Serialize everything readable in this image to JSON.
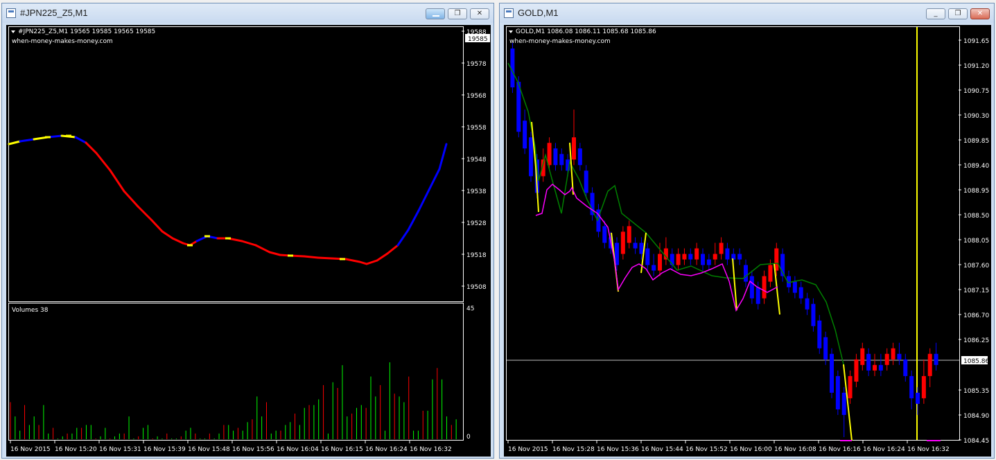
{
  "left_window": {
    "title": "#JPN225_Z5,M1",
    "header": "#JPN225_Z5,M1  19565 19585 19565 19585",
    "watermark": "when-money-makes-money.com",
    "price_labels": [
      "19588",
      "19578",
      "19568",
      "19558",
      "19548",
      "19538",
      "19528",
      "19518",
      "19508"
    ],
    "current_price": "19585",
    "volume_label": "Volumes 38",
    "volume_max": "45",
    "volume_min": "0",
    "time_labels": [
      "16 Nov 2015",
      "16 Nov 15:20",
      "16 Nov 15:31",
      "16 Nov 15:39",
      "16 Nov 15:48",
      "16 Nov 15:56",
      "16 Nov 16:04",
      "16 Nov 16:15",
      "16 Nov 16:24",
      "16 Nov 16:32"
    ]
  },
  "right_window": {
    "title": "GOLD,M1",
    "header": "GOLD,M1  1086.08 1086.11 1085.68 1085.86",
    "watermark": "when-money-makes-money.com",
    "price_labels": [
      "1091.65",
      "1091.20",
      "1090.75",
      "1090.30",
      "1089.85",
      "1089.40",
      "1088.95",
      "1088.50",
      "1088.05",
      "1087.60",
      "1087.15",
      "1086.70",
      "1086.25",
      "1085.35",
      "1084.90",
      "1084.45"
    ],
    "current_price": "1085.86",
    "time_labels": [
      "16 Nov 2015",
      "16 Nov 15:28",
      "16 Nov 15:36",
      "16 Nov 15:44",
      "16 Nov 15:52",
      "16 Nov 16:00",
      "16 Nov 16:08",
      "16 Nov 16:16",
      "16 Nov 16:24",
      "16 Nov 16:32"
    ]
  },
  "window_buttons": {
    "minimize": "_",
    "restore": "❐",
    "close": "✕"
  },
  "colors": {
    "bull": "#ff0000",
    "bear": "#0000ff",
    "trend_up": "#ffff00",
    "trend_green": "#008000",
    "magenta": "#ff00ff",
    "vol_up": "#00ff00",
    "vol_down": "#ff0000",
    "axis_text": "#ffffff",
    "bg": "#000000"
  }
}
